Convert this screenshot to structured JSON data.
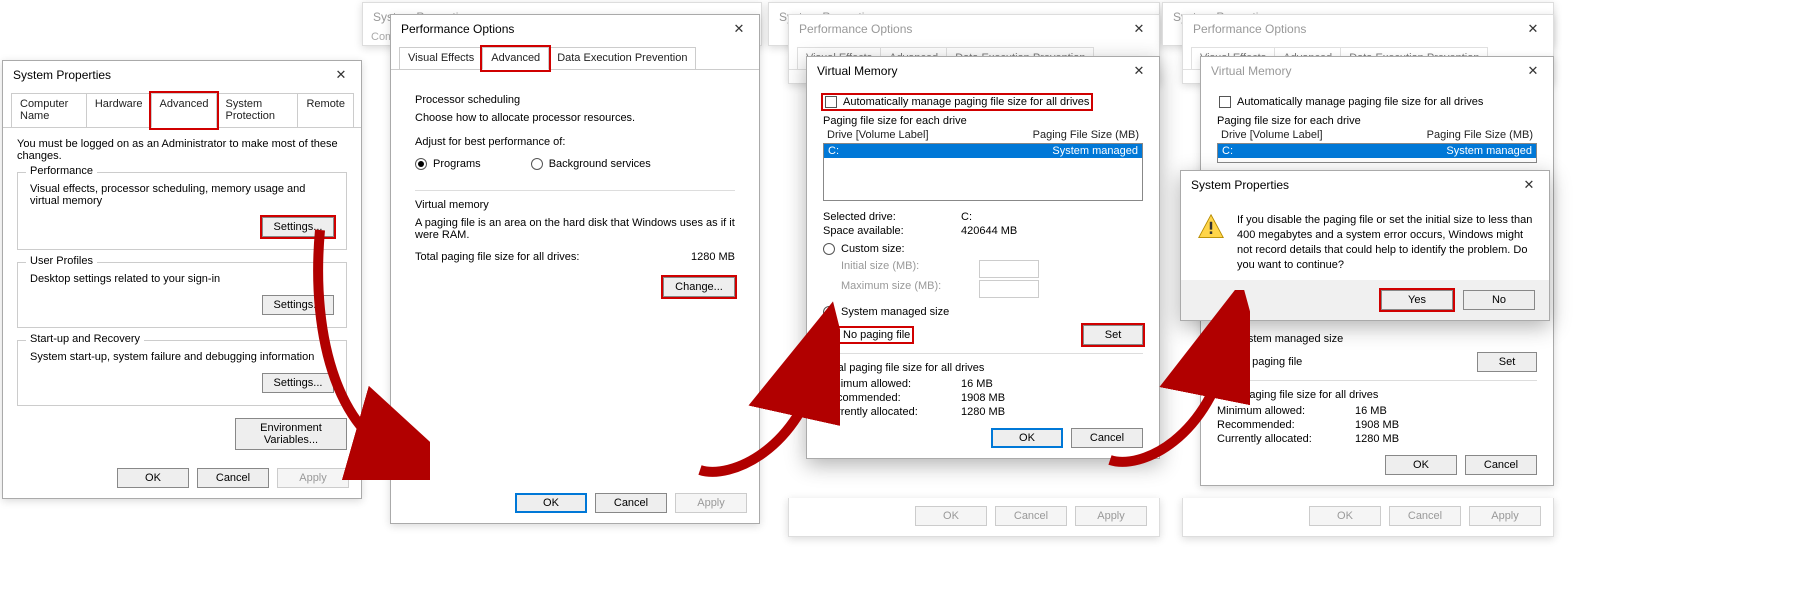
{
  "panel1": {
    "title": "System Properties",
    "tabs": [
      "Computer Name",
      "Hardware",
      "Advanced",
      "System Protection",
      "Remote"
    ],
    "adminNote": "You must be logged on as an Administrator to make most of these changes.",
    "perf": {
      "title": "Performance",
      "desc": "Visual effects, processor scheduling, memory usage and virtual memory",
      "btn": "Settings..."
    },
    "profiles": {
      "title": "User Profiles",
      "desc": "Desktop settings related to your sign-in",
      "btn": "Settings..."
    },
    "startup": {
      "title": "Start-up and Recovery",
      "desc": "System start-up, system failure and debugging information",
      "btn": "Settings..."
    },
    "envBtn": "Environment Variables...",
    "ok": "OK",
    "cancel": "Cancel",
    "apply": "Apply"
  },
  "panel2": {
    "bgTitle": "System Properties",
    "title": "Performance Options",
    "tabs": [
      "Visual Effects",
      "Advanced",
      "Data Execution Prevention"
    ],
    "sched": {
      "title": "Processor scheduling",
      "desc": "Choose how to allocate processor resources.",
      "adjust": "Adjust for best performance of:",
      "opt1": "Programs",
      "opt2": "Background services"
    },
    "vm": {
      "title": "Virtual memory",
      "desc": "A paging file is an area on the hard disk that Windows uses as if it were RAM.",
      "totalLabel": "Total paging file size for all drives:",
      "totalVal": "1280 MB",
      "btn": "Change..."
    },
    "ok": "OK",
    "cancel": "Cancel",
    "apply": "Apply"
  },
  "panel3": {
    "bgTitle": "System Properties",
    "perfTitle": "Performance Options",
    "perfTabs": [
      "Visual Effects",
      "Advanced",
      "Data Execution Prevention"
    ],
    "title": "Virtual Memory",
    "autoChk": "Automatically manage paging file size for all drives",
    "eachDrive": "Paging file size for each drive",
    "colDrive": "Drive  [Volume Label]",
    "colSize": "Paging File Size (MB)",
    "rowDrive": "C:",
    "rowSize": "System managed",
    "selDriveLbl": "Selected drive:",
    "selDriveVal": "C:",
    "spaceLbl": "Space available:",
    "spaceVal": "420644 MB",
    "custom": "Custom size:",
    "initLbl": "Initial size (MB):",
    "maxLbl": "Maximum size (MB):",
    "sysMan": "System managed size",
    "noPage": "No paging file",
    "setBtn": "Set",
    "totalTitle": "Total paging file size for all drives",
    "minLbl": "Minimum allowed:",
    "minVal": "16 MB",
    "recLbl": "Recommended:",
    "recVal": "1908 MB",
    "curLbl": "Currently allocated:",
    "curVal": "1280 MB",
    "ok": "OK",
    "cancel": "Cancel",
    "apply": "Apply"
  },
  "panel4": {
    "bgTitle": "System Properties",
    "perfTitle": "Performance Options",
    "vmTitle": "Virtual Memory",
    "autoChk": "Automatically manage paging file size for all drives",
    "eachDrive": "Paging file size for each drive",
    "colDrive": "Drive  [Volume Label]",
    "colSize": "Paging File Size (MB)",
    "rowDrive": "C:",
    "rowSize": "System managed",
    "sysMan": "System managed size",
    "noPage": "No paging file",
    "setBtn": "Set",
    "totalTitle": "Total paging file size for all drives",
    "minLbl": "Minimum allowed:",
    "minVal": "16 MB",
    "recLbl": "Recommended:",
    "recVal": "1908 MB",
    "curLbl": "Currently allocated:",
    "curVal": "1280 MB",
    "ok": "OK",
    "cancel": "Cancel",
    "apply": "Apply",
    "msg": {
      "title": "System Properties",
      "text": "If you disable the paging file or set the initial size to less than 400 megabytes and a system error occurs, Windows might not record details that could help to identify the problem. Do you want to continue?",
      "yes": "Yes",
      "no": "No"
    }
  }
}
